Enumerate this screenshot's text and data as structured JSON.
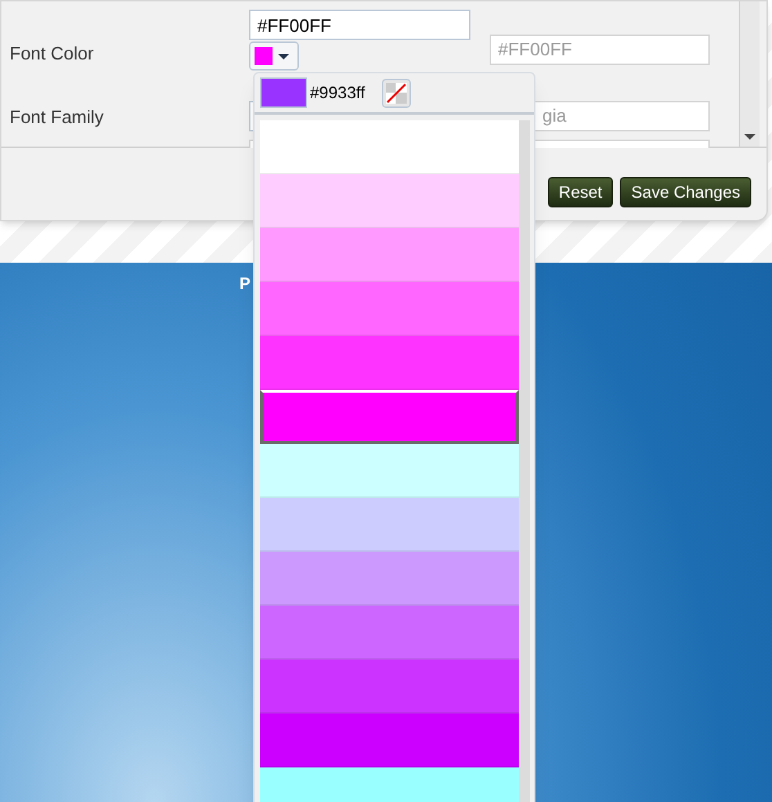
{
  "settings": {
    "rows": [
      {
        "label": "Font Color",
        "value": "#FF00FF",
        "preview": "#FF00FF"
      },
      {
        "label": "Font Family",
        "preview": "gia"
      }
    ]
  },
  "buttons": [
    {
      "label": "Reset"
    },
    {
      "label": "Save Changes"
    }
  ],
  "background_text": "P",
  "color_picker": {
    "current_hex": "#9933ff",
    "swatches": [
      {
        "color": "#ffffff",
        "selected": false
      },
      {
        "color": "#ffccff",
        "selected": false
      },
      {
        "color": "#ff99ff",
        "selected": false
      },
      {
        "color": "#ff66ff",
        "selected": false
      },
      {
        "color": "#ff33ff",
        "selected": false
      },
      {
        "color": "#ff00ff",
        "selected": true
      },
      {
        "color": "#ccffff",
        "selected": false
      },
      {
        "color": "#ccccff",
        "selected": false
      },
      {
        "color": "#cc99ff",
        "selected": false
      },
      {
        "color": "#cc66ff",
        "selected": false
      },
      {
        "color": "#cc33ff",
        "selected": false
      },
      {
        "color": "#cc00ff",
        "selected": false
      },
      {
        "color": "#99ffff",
        "selected": false
      }
    ]
  }
}
